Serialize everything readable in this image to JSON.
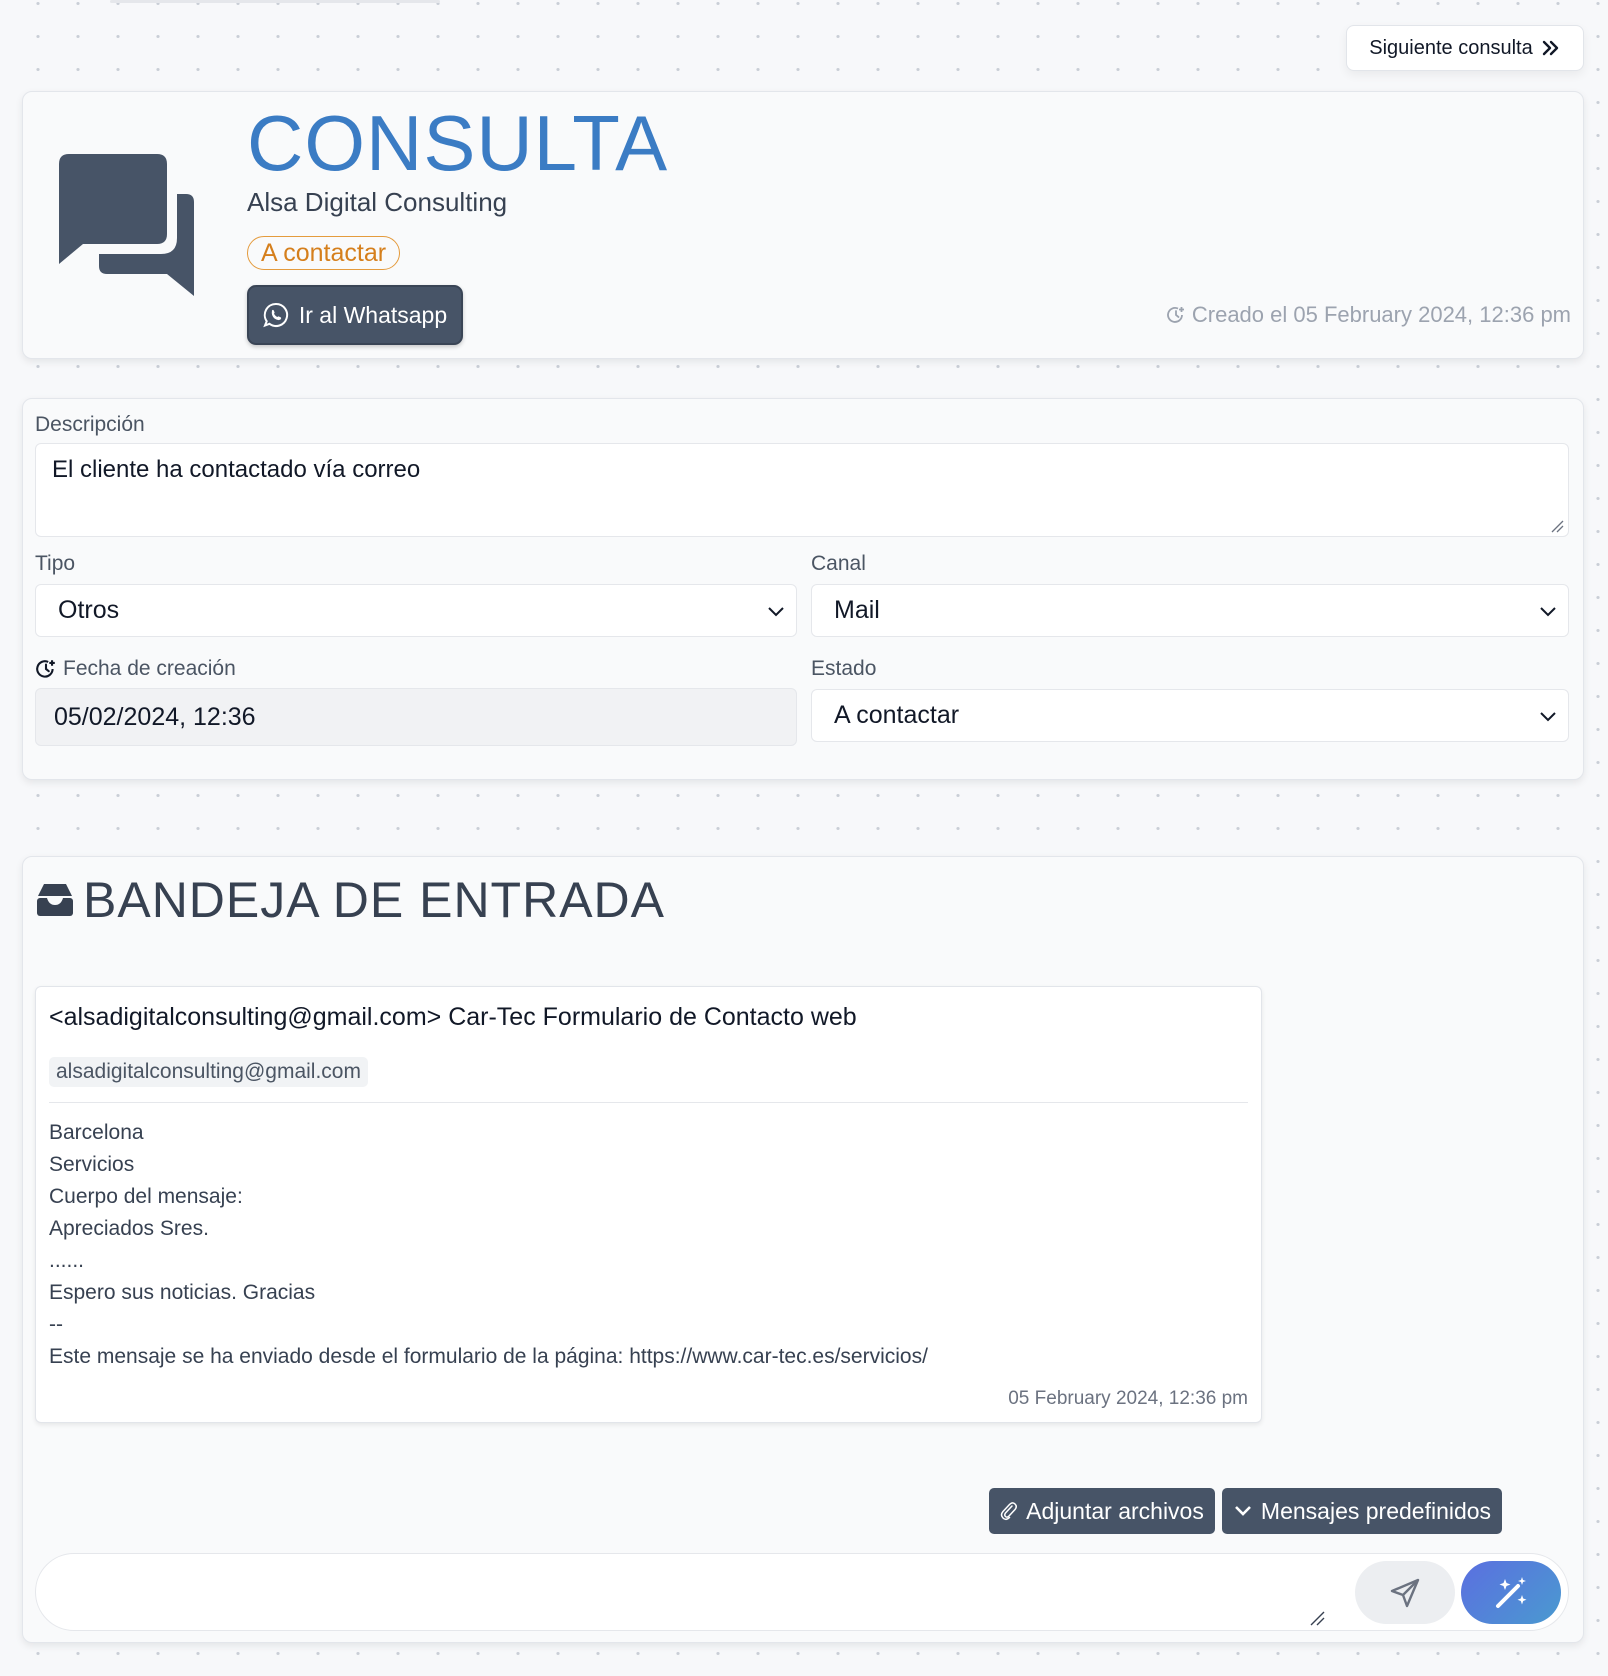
{
  "nav": {
    "next_label": "Siguiente consulta"
  },
  "header": {
    "title": "CONSULTA",
    "company": "Alsa Digital Consulting",
    "status": "A contactar",
    "whatsapp_label": "Ir al Whatsapp",
    "created": "Creado el 05 February 2024, 12:36 pm"
  },
  "form": {
    "description_label": "Descripción",
    "description_value": "El cliente ha contactado vía correo",
    "tipo_label": "Tipo",
    "tipo_value": "Otros",
    "canal_label": "Canal",
    "canal_value": "Mail",
    "fecha_label": "Fecha de creación",
    "fecha_value": "05/02/2024, 12:36",
    "estado_label": "Estado",
    "estado_value": "A contactar"
  },
  "inbox": {
    "title": "BANDEJA DE ENTRADA",
    "message": {
      "subject": "<alsadigitalconsulting@gmail.com> Car-Tec Formulario de Contacto web",
      "from": "alsadigitalconsulting@gmail.com",
      "body": [
        "Barcelona",
        "Servicios",
        "Cuerpo del mensaje:",
        "Apreciados Sres.",
        "......",
        "Espero sus noticias. Gracias",
        "--",
        "Este mensaje se ha enviado desde el formulario de la página: https://www.car-tec.es/servicios/"
      ],
      "date": "05 February 2024, 12:36 pm"
    },
    "attach_label": "Adjuntar archivos",
    "predefined_label": "Mensajes predefinidos"
  },
  "colors": {
    "accent": "#3b7cc4",
    "status": "#d57f1c",
    "dark_button": "#475467"
  }
}
